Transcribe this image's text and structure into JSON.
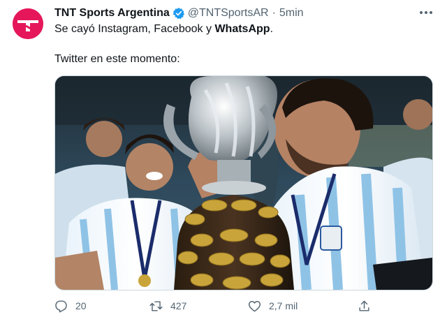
{
  "tweet": {
    "author_name": "TNT Sports Argentina",
    "handle": "@TNTSportsAR",
    "separator": "·",
    "time": "5min",
    "text_line1_prefix": "Se cayó Instagram, Facebook y ",
    "text_line1_bold": "WhatsApp",
    "text_line1_suffix": ".",
    "text_line2": "Twitter en este momento:"
  },
  "actions": {
    "reply_count": "20",
    "retweet_count": "427",
    "like_count": "2,7 mil"
  },
  "icons": {
    "avatar": "tnt-logo-icon",
    "verified": "verified-badge-icon",
    "more": "more-horizontal-icon",
    "reply": "reply-icon",
    "retweet": "retweet-icon",
    "like": "heart-icon",
    "share": "share-icon"
  },
  "colors": {
    "brand": "#e5175a",
    "verified": "#1d9bf0",
    "secondary_text": "#536471"
  }
}
